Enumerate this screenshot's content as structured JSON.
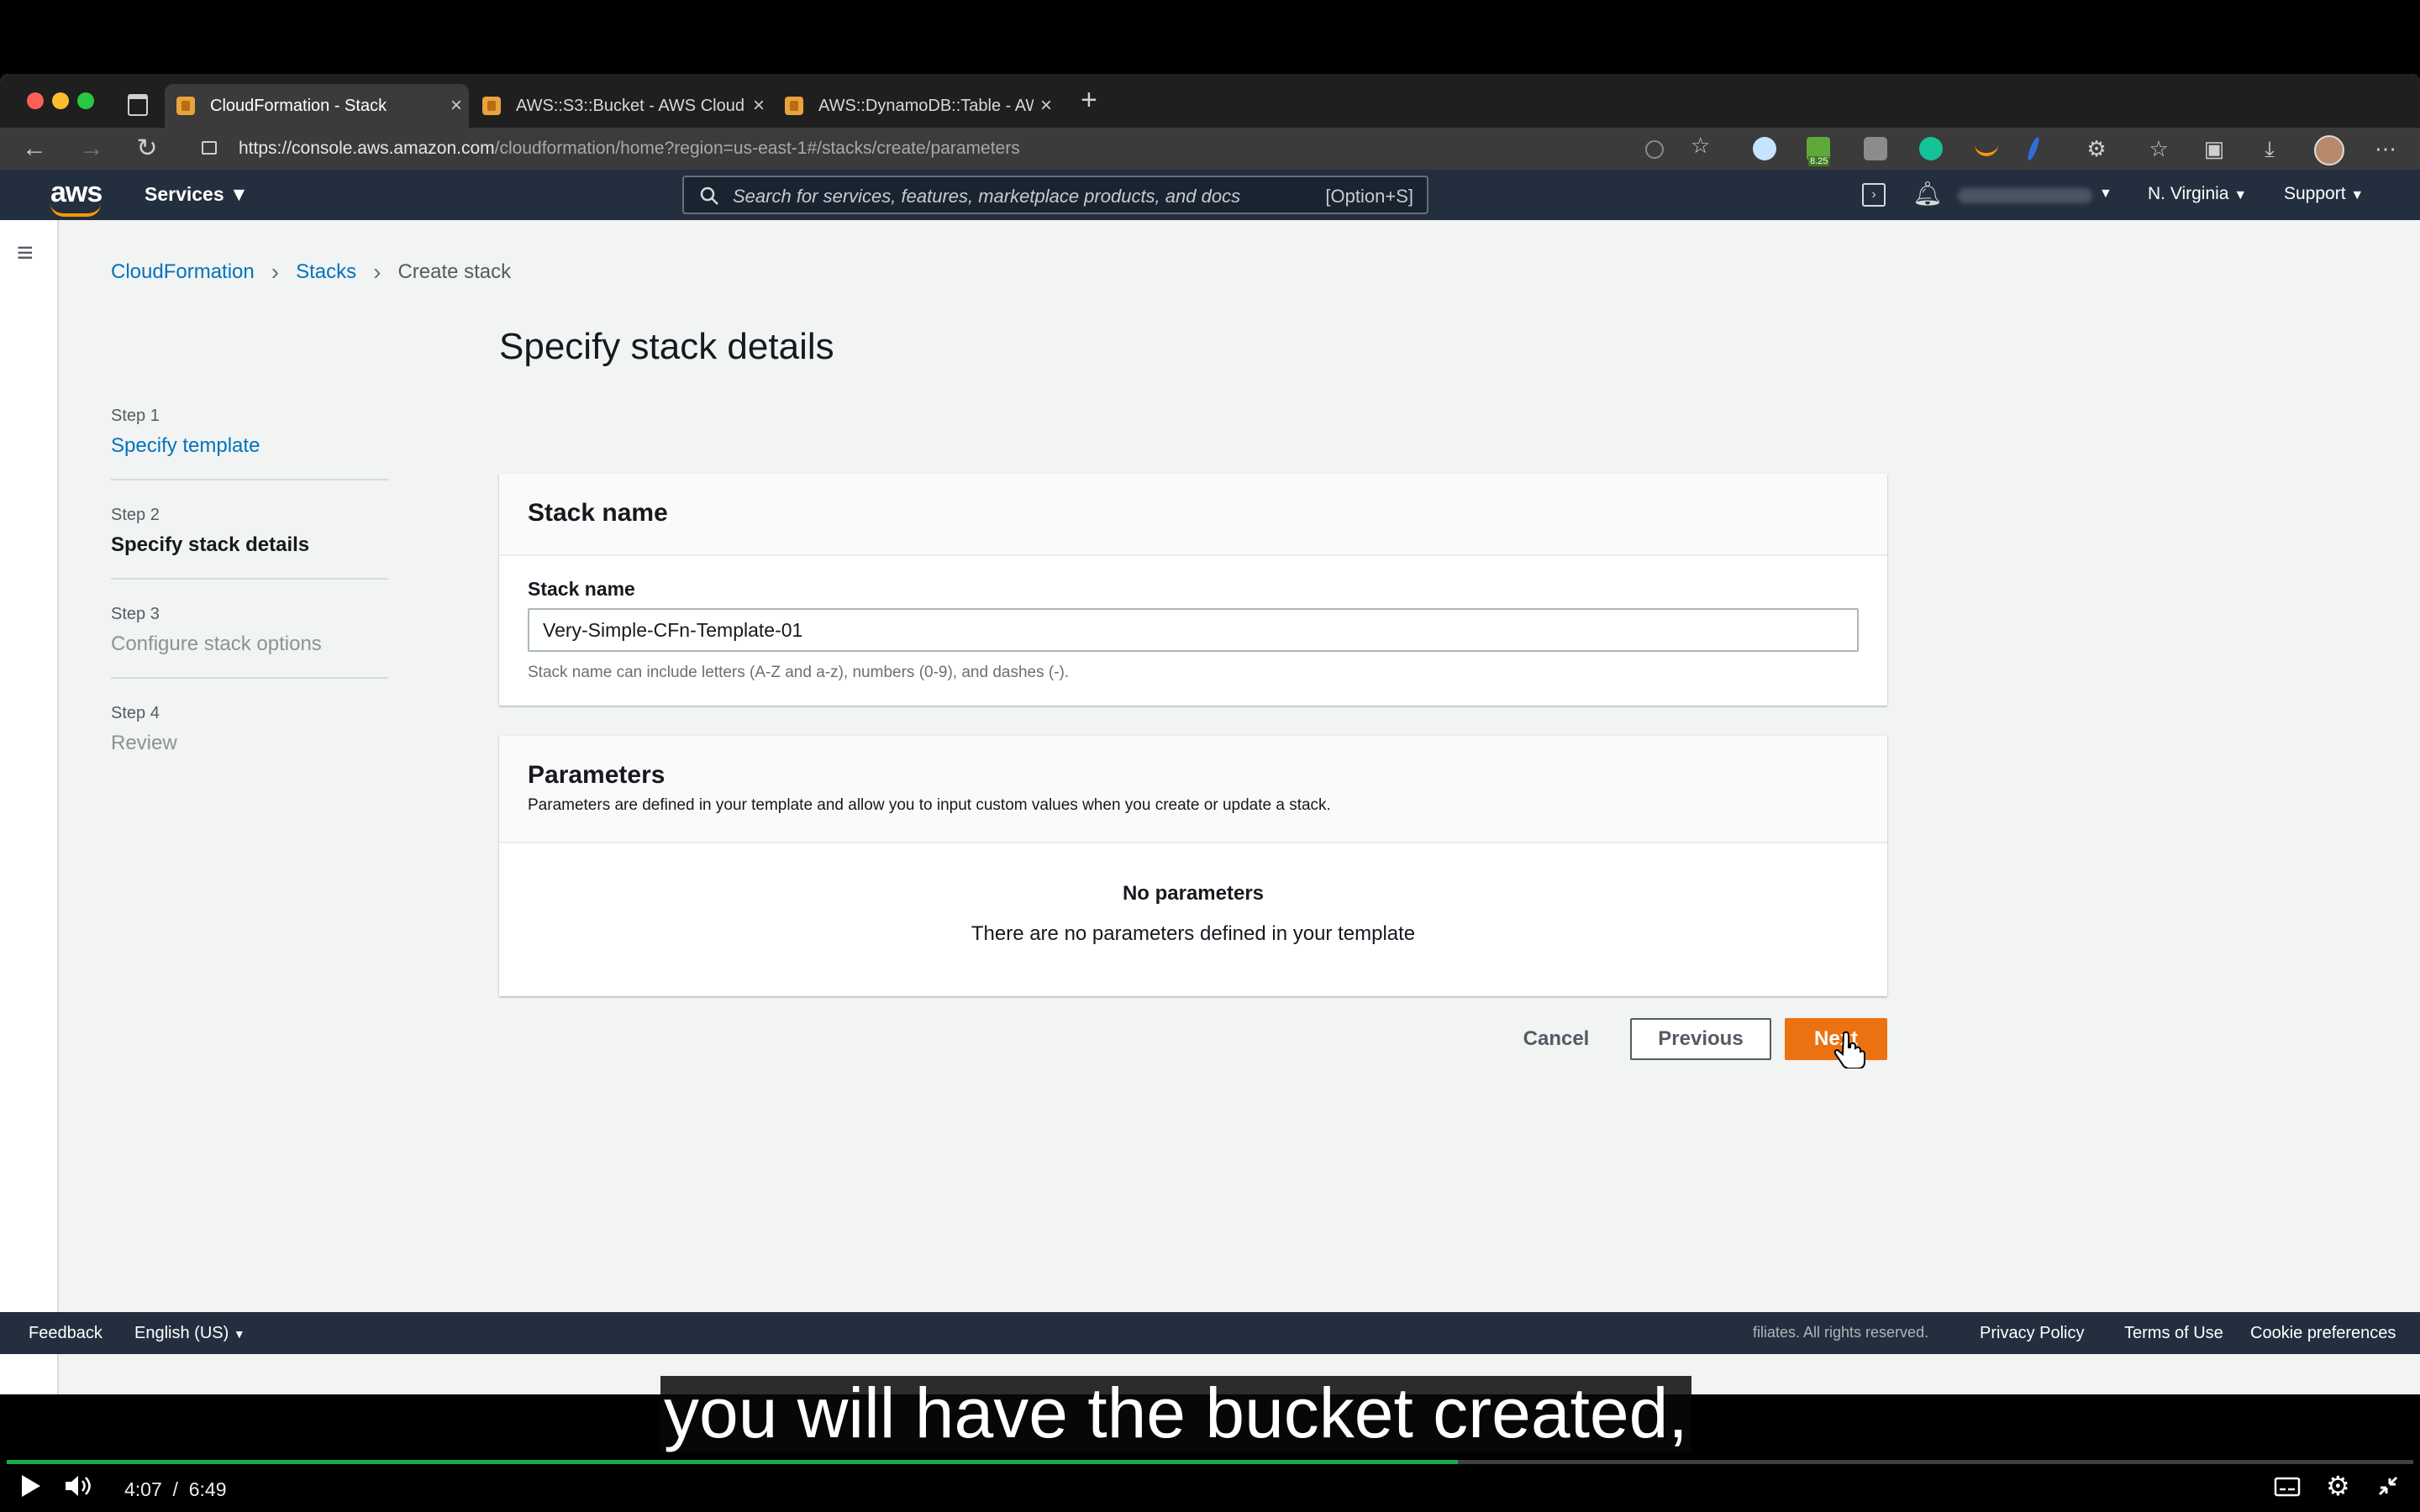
{
  "browser": {
    "tabs": [
      {
        "title": "CloudFormation - Stack",
        "active": true
      },
      {
        "title": "AWS::S3::Bucket - AWS Cloud",
        "active": false
      },
      {
        "title": "AWS::DynamoDB::Table - AWS",
        "active": false
      }
    ],
    "url_host": "https://console.aws.amazon.com",
    "url_rest": "/cloudformation/home?region=us-east-1#/stacks/create/parameters",
    "extension_badge": "8.25"
  },
  "aws_header": {
    "logo": "aws",
    "services_label": "Services",
    "search_placeholder": "Search for services, features, marketplace products, and docs",
    "search_shortcut": "[Option+S]",
    "region": "N. Virginia",
    "support": "Support"
  },
  "breadcrumb": [
    "CloudFormation",
    "Stacks",
    "Create stack"
  ],
  "steps": [
    {
      "num": "Step 1",
      "label": "Specify template",
      "state": "link"
    },
    {
      "num": "Step 2",
      "label": "Specify stack details",
      "state": "current"
    },
    {
      "num": "Step 3",
      "label": "Configure stack options",
      "state": "disabled"
    },
    {
      "num": "Step 4",
      "label": "Review",
      "state": "disabled"
    }
  ],
  "page_title": "Specify stack details",
  "stack_name_panel": {
    "title": "Stack name",
    "field_label": "Stack name",
    "field_value": "Very-Simple-CFn-Template-01",
    "hint": "Stack name can include letters (A-Z and a-z), numbers (0-9), and dashes (-)."
  },
  "parameters_panel": {
    "title": "Parameters",
    "description": "Parameters are defined in your template and allow you to input custom values when you create or update a stack.",
    "empty_title": "No parameters",
    "empty_text": "There are no parameters defined in your template"
  },
  "actions": {
    "cancel": "Cancel",
    "previous": "Previous",
    "next": "Next"
  },
  "footer": {
    "feedback": "Feedback",
    "language": "English (US)",
    "copyright": "filiates. All rights reserved.",
    "privacy": "Privacy Policy",
    "terms": "Terms of Use",
    "cookies": "Cookie preferences"
  },
  "video": {
    "caption": "you will have the bucket created,",
    "current_time": "4:07",
    "duration": "6:49",
    "progress_fraction": 0.603
  },
  "colors": {
    "aws_nav": "#232f3e",
    "link_blue": "#0073bb",
    "primary_orange": "#ec7211",
    "progress_green": "#19a94d"
  }
}
